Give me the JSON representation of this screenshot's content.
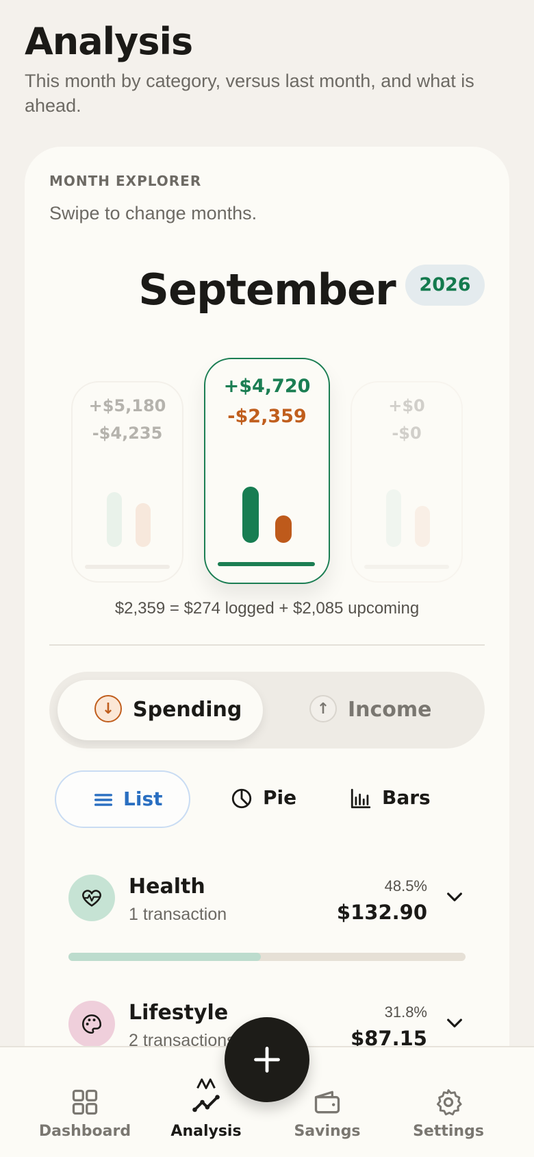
{
  "header": {
    "title": "Analysis",
    "subtitle": "This month by category, versus last month, and what is ahead."
  },
  "explorer": {
    "eyebrow": "MONTH EXPLORER",
    "hint": "Swipe to change months.",
    "month": "September",
    "year": "2026",
    "months": [
      {
        "position": "previous",
        "income": "+$5,180",
        "expense": "-$4,235"
      },
      {
        "position": "current",
        "income": "+$4,720",
        "expense": "-$2,359"
      },
      {
        "position": "next",
        "income": "+$0",
        "expense": "-$0"
      }
    ],
    "summary": "$2,359 = $274 logged + $2,085 upcoming"
  },
  "toggle": {
    "spending_label": "Spending",
    "income_label": "Income",
    "selected": "Spending"
  },
  "views": {
    "list_label": "List",
    "pie_label": "Pie",
    "bars_label": "Bars",
    "selected": "List"
  },
  "categories": [
    {
      "name": "Health",
      "sub": "1 transaction",
      "pct": "48.5%",
      "amount": "$132.90",
      "share": 0.485,
      "icon": "heart-pulse-icon",
      "color": "#c6e3d4",
      "bar_color": "#bcdccd"
    },
    {
      "name": "Lifestyle",
      "sub": "2 transactions",
      "pct": "31.8%",
      "amount": "$87.15",
      "share": 0.318,
      "icon": "palette-icon",
      "color": "#efcfdb",
      "bar_color": "#e9bfd0"
    }
  ],
  "nav": {
    "items": [
      {
        "label": "Dashboard",
        "icon": "grid-icon"
      },
      {
        "label": "Analysis",
        "icon": "trend-line-icon"
      },
      {
        "label": "Savings",
        "icon": "wallet-icon"
      },
      {
        "label": "Settings",
        "icon": "gear-icon"
      }
    ],
    "active": "Analysis",
    "add_icon": "plus-icon"
  },
  "colors": {
    "income": "#1b7e53",
    "expense": "#c05e1d",
    "accent_blue": "#2a6fc1",
    "background": "#f4f1ec",
    "card": "#fcfbf6"
  }
}
